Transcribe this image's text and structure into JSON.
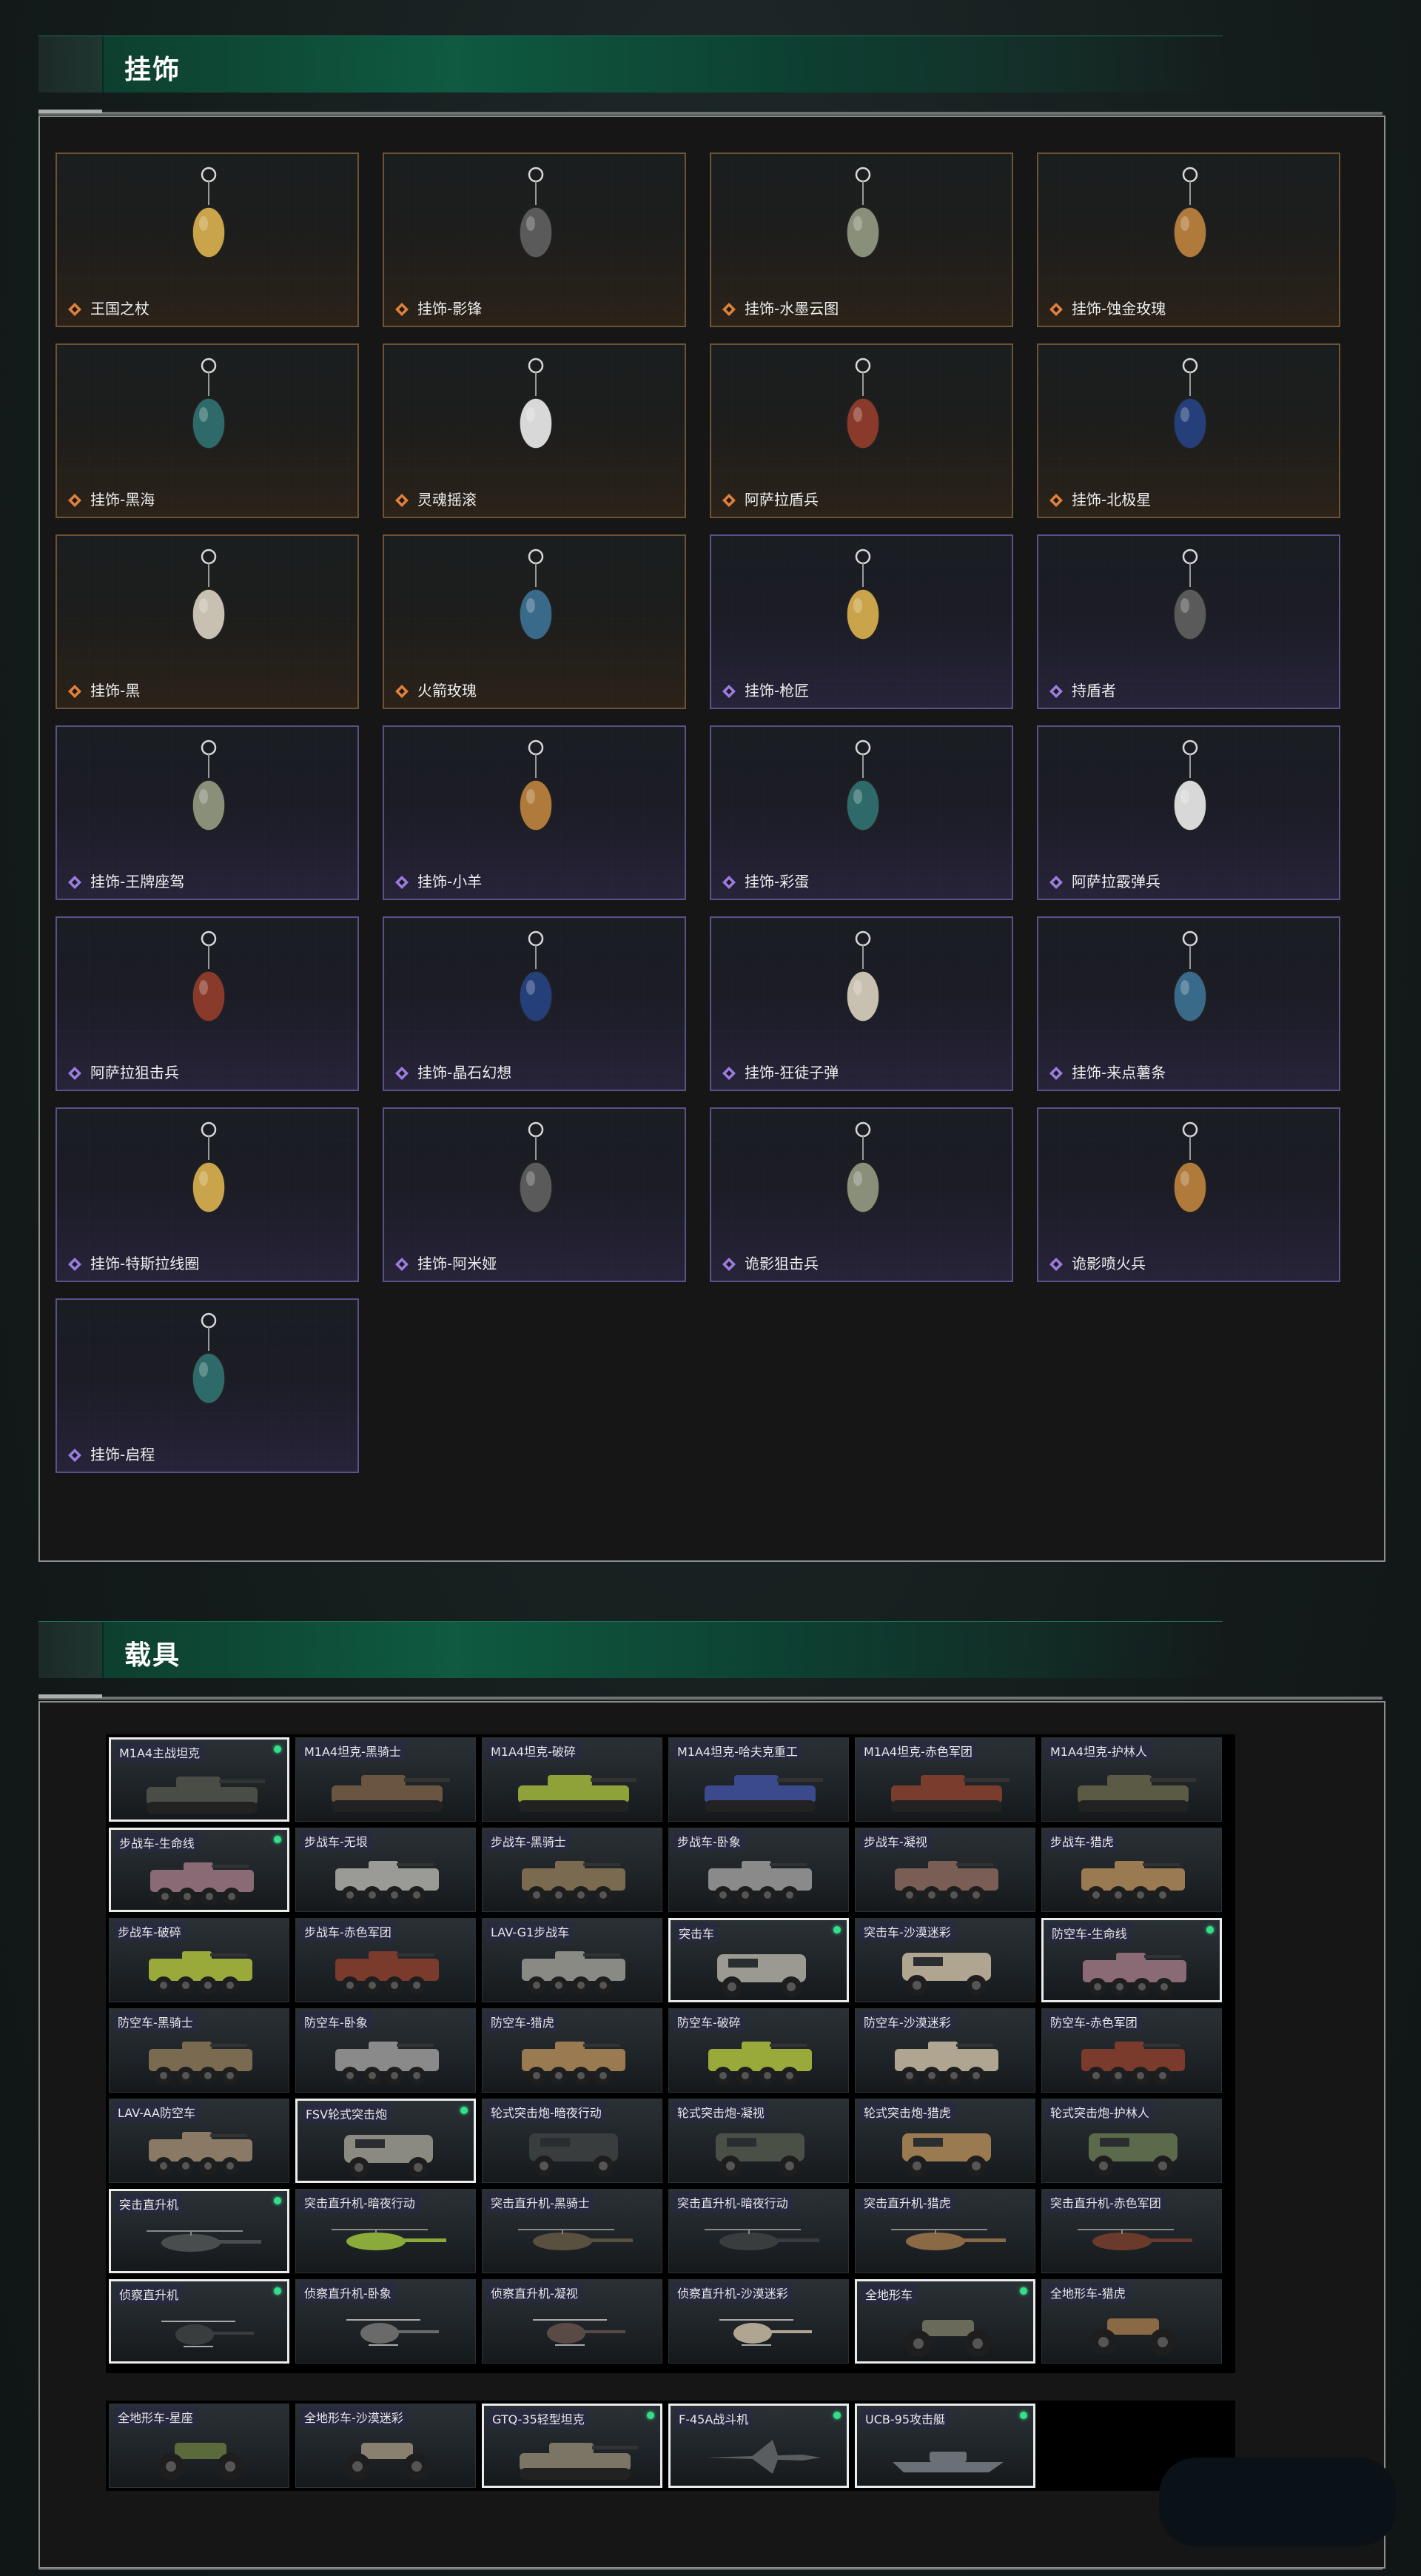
{
  "sections": {
    "charms_title": "挂饰",
    "vehicles_title": "载具"
  },
  "charms": [
    {
      "name": "王国之杖",
      "rarity": "orange",
      "icon": "scepter-charm-icon"
    },
    {
      "name": "挂饰-影锋",
      "rarity": "orange",
      "icon": "shadow-blade-charm-icon"
    },
    {
      "name": "挂饰-水墨云图",
      "rarity": "orange",
      "icon": "ink-cloud-charm-icon"
    },
    {
      "name": "挂饰-蚀金玫瑰",
      "rarity": "orange",
      "icon": "gold-rose-charm-icon"
    },
    {
      "name": "挂饰-黑海",
      "rarity": "orange",
      "icon": "anchor-charm-icon"
    },
    {
      "name": "灵魂摇滚",
      "rarity": "orange",
      "icon": "guitar-charm-icon"
    },
    {
      "name": "阿萨拉盾兵",
      "rarity": "orange",
      "icon": "shield-soldier-charm-icon"
    },
    {
      "name": "挂饰-北极星",
      "rarity": "orange",
      "icon": "north-star-charm-icon"
    },
    {
      "name": "挂饰-黑",
      "rarity": "orange",
      "icon": "black-charm-icon"
    },
    {
      "name": "火箭玫瑰",
      "rarity": "orange",
      "icon": "rocket-rose-charm-icon"
    },
    {
      "name": "挂饰-枪匠",
      "rarity": "purple",
      "icon": "gunsmith-charm-icon"
    },
    {
      "name": "持盾者",
      "rarity": "purple",
      "icon": "shield-bearer-charm-icon"
    },
    {
      "name": "挂饰-王牌座驾",
      "rarity": "purple",
      "icon": "jet-charm-icon"
    },
    {
      "name": "挂饰-小羊",
      "rarity": "purple",
      "icon": "lamb-charm-icon"
    },
    {
      "name": "挂饰-彩蛋",
      "rarity": "purple",
      "icon": "egg-charm-icon"
    },
    {
      "name": "阿萨拉霰弹兵",
      "rarity": "purple",
      "icon": "shotgunner-charm-icon"
    },
    {
      "name": "阿萨拉狙击兵",
      "rarity": "purple",
      "icon": "sniper-charm-icon"
    },
    {
      "name": "挂饰-晶石幻想",
      "rarity": "purple",
      "icon": "crystal-charm-icon"
    },
    {
      "name": "挂饰-狂徒子弹",
      "rarity": "purple",
      "icon": "bullet-charm-icon"
    },
    {
      "name": "挂饰-来点薯条",
      "rarity": "purple",
      "icon": "fries-charm-icon"
    },
    {
      "name": "挂饰-特斯拉线圈",
      "rarity": "purple",
      "icon": "tesla-coil-charm-icon"
    },
    {
      "name": "挂饰-阿米娅",
      "rarity": "purple",
      "icon": "amiya-charm-icon"
    },
    {
      "name": "诡影狙击兵",
      "rarity": "purple",
      "icon": "ghost-sniper-charm-icon"
    },
    {
      "name": "诡影喷火兵",
      "rarity": "purple",
      "icon": "ghost-flamer-charm-icon"
    },
    {
      "name": "挂饰-启程",
      "rarity": "purple",
      "icon": "departure-charm-icon"
    }
  ],
  "vehicles": [
    {
      "name": "M1A4主战坦克",
      "selected": true,
      "owned": true,
      "kind": "tank",
      "color": "#4a4d45"
    },
    {
      "name": "M1A4坦克-黑骑士",
      "selected": false,
      "owned": false,
      "kind": "tank",
      "color": "#6a5540"
    },
    {
      "name": "M1A4坦克-破碎",
      "selected": false,
      "owned": false,
      "kind": "tank",
      "color": "#8fa23a"
    },
    {
      "name": "M1A4坦克-哈夫克重工",
      "selected": false,
      "owned": false,
      "kind": "tank",
      "color": "#3b4a8c"
    },
    {
      "name": "M1A4坦克-赤色军团",
      "selected": false,
      "owned": false,
      "kind": "tank",
      "color": "#7a3c2c"
    },
    {
      "name": "M1A4坦克-护林人",
      "selected": false,
      "owned": false,
      "kind": "tank",
      "color": "#5b5a45"
    },
    {
      "name": "步战车-生命线",
      "selected": true,
      "owned": true,
      "kind": "ifv",
      "color": "#8a6a75"
    },
    {
      "name": "步战车-无垠",
      "selected": false,
      "owned": false,
      "kind": "ifv",
      "color": "#9a9a96"
    },
    {
      "name": "步战车-黑骑士",
      "selected": false,
      "owned": false,
      "kind": "ifv",
      "color": "#7a6a50"
    },
    {
      "name": "步战车-卧象",
      "selected": false,
      "owned": false,
      "kind": "ifv",
      "color": "#8a8a8a"
    },
    {
      "name": "步战车-凝视",
      "selected": false,
      "owned": false,
      "kind": "ifv",
      "color": "#7a5e55"
    },
    {
      "name": "步战车-猎虎",
      "selected": false,
      "owned": false,
      "kind": "ifv",
      "color": "#9a7a50"
    },
    {
      "name": "步战车-破碎",
      "selected": false,
      "owned": false,
      "kind": "ifv",
      "color": "#9aaa3a"
    },
    {
      "name": "步战车-赤色军团",
      "selected": false,
      "owned": false,
      "kind": "ifv",
      "color": "#7a3a2c"
    },
    {
      "name": "LAV-G1步战车",
      "selected": false,
      "owned": false,
      "kind": "ifv",
      "color": "#8a8a85"
    },
    {
      "name": "突击车",
      "selected": true,
      "owned": true,
      "kind": "assault",
      "color": "#9a9a92"
    },
    {
      "name": "突击车-沙漠迷彩",
      "selected": false,
      "owned": false,
      "kind": "assault",
      "color": "#b0a590"
    },
    {
      "name": "防空车-生命线",
      "selected": true,
      "owned": true,
      "kind": "ifv",
      "color": "#8a6a75"
    },
    {
      "name": "防空车-黑骑士",
      "selected": false,
      "owned": false,
      "kind": "ifv",
      "color": "#7a6a50"
    },
    {
      "name": "防空车-卧象",
      "selected": false,
      "owned": false,
      "kind": "ifv",
      "color": "#8a8a8a"
    },
    {
      "name": "防空车-猎虎",
      "selected": false,
      "owned": false,
      "kind": "ifv",
      "color": "#9a7a50"
    },
    {
      "name": "防空车-破碎",
      "selected": false,
      "owned": false,
      "kind": "ifv",
      "color": "#9aaa3a"
    },
    {
      "name": "防空车-沙漠迷彩",
      "selected": false,
      "owned": false,
      "kind": "ifv",
      "color": "#b0a590"
    },
    {
      "name": "防空车-赤色军团",
      "selected": false,
      "owned": false,
      "kind": "ifv",
      "color": "#7a3a2c"
    },
    {
      "name": "LAV-AA防空车",
      "selected": false,
      "owned": false,
      "kind": "ifv",
      "color": "#8a7a65"
    },
    {
      "name": "FSV轮式突击炮",
      "selected": true,
      "owned": true,
      "kind": "assault",
      "color": "#8a8a80"
    },
    {
      "name": "轮式突击炮-暗夜行动",
      "selected": false,
      "owned": false,
      "kind": "assault",
      "color": "#3a3d3d"
    },
    {
      "name": "轮式突击炮-凝视",
      "selected": false,
      "owned": false,
      "kind": "assault",
      "color": "#4a5045"
    },
    {
      "name": "轮式突击炮-猎虎",
      "selected": false,
      "owned": false,
      "kind": "assault",
      "color": "#9a7a50"
    },
    {
      "name": "轮式突击炮-护林人",
      "selected": false,
      "owned": false,
      "kind": "assault",
      "color": "#5b6a4a"
    },
    {
      "name": "突击直升机",
      "selected": true,
      "owned": true,
      "kind": "heli",
      "color": "#4a4d4d"
    },
    {
      "name": "突击直升机-暗夜行动",
      "selected": false,
      "owned": false,
      "kind": "heli",
      "color": "#8aaa3a"
    },
    {
      "name": "突击直升机-黑骑士",
      "selected": false,
      "owned": false,
      "kind": "heli",
      "color": "#5a5040"
    },
    {
      "name": "突击直升机-暗夜行动",
      "selected": false,
      "owned": false,
      "kind": "heli",
      "color": "#3a3d3d"
    },
    {
      "name": "突击直升机-猎虎",
      "selected": false,
      "owned": false,
      "kind": "heli",
      "color": "#8a6a45"
    },
    {
      "name": "突击直升机-赤色军团",
      "selected": false,
      "owned": false,
      "kind": "heli",
      "color": "#6a3a2c"
    },
    {
      "name": "侦察直升机",
      "selected": true,
      "owned": true,
      "kind": "scout",
      "color": "#3a3d3d"
    },
    {
      "name": "侦察直升机-卧象",
      "selected": false,
      "owned": false,
      "kind": "scout",
      "color": "#6a6a6a"
    },
    {
      "name": "侦察直升机-凝视",
      "selected": false,
      "owned": false,
      "kind": "scout",
      "color": "#5a4a45"
    },
    {
      "name": "侦察直升机-沙漠迷彩",
      "selected": false,
      "owned": false,
      "kind": "scout",
      "color": "#b0a590"
    },
    {
      "name": "全地形车",
      "selected": true,
      "owned": true,
      "kind": "atv",
      "color": "#6a6a5a"
    },
    {
      "name": "全地形车-猎虎",
      "selected": false,
      "owned": false,
      "kind": "atv",
      "color": "#8a6a45"
    }
  ],
  "vehicles_extra": [
    {
      "name": "全地形车-星座",
      "selected": false,
      "owned": false,
      "kind": "atv",
      "color": "#5a6a3a"
    },
    {
      "name": "全地形车-沙漠迷彩",
      "selected": false,
      "owned": false,
      "kind": "atv",
      "color": "#8a8070"
    },
    {
      "name": "GTQ-35轻型坦克",
      "selected": true,
      "owned": true,
      "kind": "tank",
      "color": "#7a7565"
    },
    {
      "name": "F-45A战斗机",
      "selected": true,
      "owned": true,
      "kind": "jet",
      "color": "#5a5d60"
    },
    {
      "name": "UCB-95攻击艇",
      "selected": true,
      "owned": true,
      "kind": "boat",
      "color": "#6a7075"
    }
  ],
  "colors": {
    "orange_rarity": "#e0803a",
    "purple_rarity": "#9a7ce0",
    "accent_green": "#0f5a40",
    "owned_dot": "#33e08a"
  }
}
